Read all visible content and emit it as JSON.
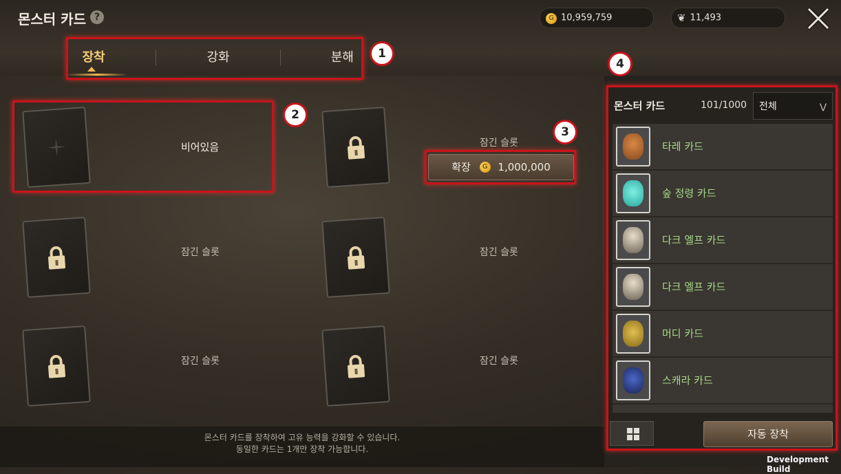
{
  "header": {
    "title": "몬스터 카드",
    "help_icon": "?"
  },
  "currency": {
    "gold": "10,959,759",
    "gem": "11,493",
    "gold_icon": "G"
  },
  "tabs": [
    {
      "label": "장착",
      "active": true
    },
    {
      "label": "강화",
      "active": false
    },
    {
      "label": "분해",
      "active": false
    }
  ],
  "slots": [
    {
      "state": "empty",
      "label": "비어있음"
    },
    {
      "state": "locked",
      "label": "잠긴 슬롯"
    },
    {
      "state": "locked",
      "label": "잠긴 슬롯"
    },
    {
      "state": "locked",
      "label": "잠긴 슬롯"
    },
    {
      "state": "locked",
      "label": "잠긴 슬롯"
    },
    {
      "state": "locked",
      "label": "잠긴 슬롯"
    }
  ],
  "expand": {
    "label": "확장",
    "cost": "1,000,000",
    "coin": "G"
  },
  "badges": [
    "1",
    "2",
    "3",
    "4"
  ],
  "notice": {
    "line1": "몬스터 카드를 장착하여 고유 능력을 강화할 수 있습니다.",
    "line2": "동일한 카드는 1개만 장착 가능합니다."
  },
  "panel": {
    "title": "몬스터 카드",
    "count": "101/1000",
    "filter": "전체",
    "cards": [
      {
        "name": "타레 카드",
        "icon": "tare-card-icon"
      },
      {
        "name": "숲 정령 카드",
        "icon": "forest-spirit-card-icon"
      },
      {
        "name": "다크 엘프 카드",
        "icon": "dark-elf-card-icon"
      },
      {
        "name": "다크 엘프 카드",
        "icon": "dark-elf-card-icon"
      },
      {
        "name": "머디 카드",
        "icon": "muddy-card-icon"
      },
      {
        "name": "스캐라 카드",
        "icon": "scara-card-icon"
      }
    ],
    "auto_equip": "자동 장착"
  },
  "footer": {
    "dev_build": "Development Build"
  },
  "colors": {
    "accent": "#f5ce79",
    "highlight": "#c8141a",
    "card_name": "#a8d88a"
  }
}
